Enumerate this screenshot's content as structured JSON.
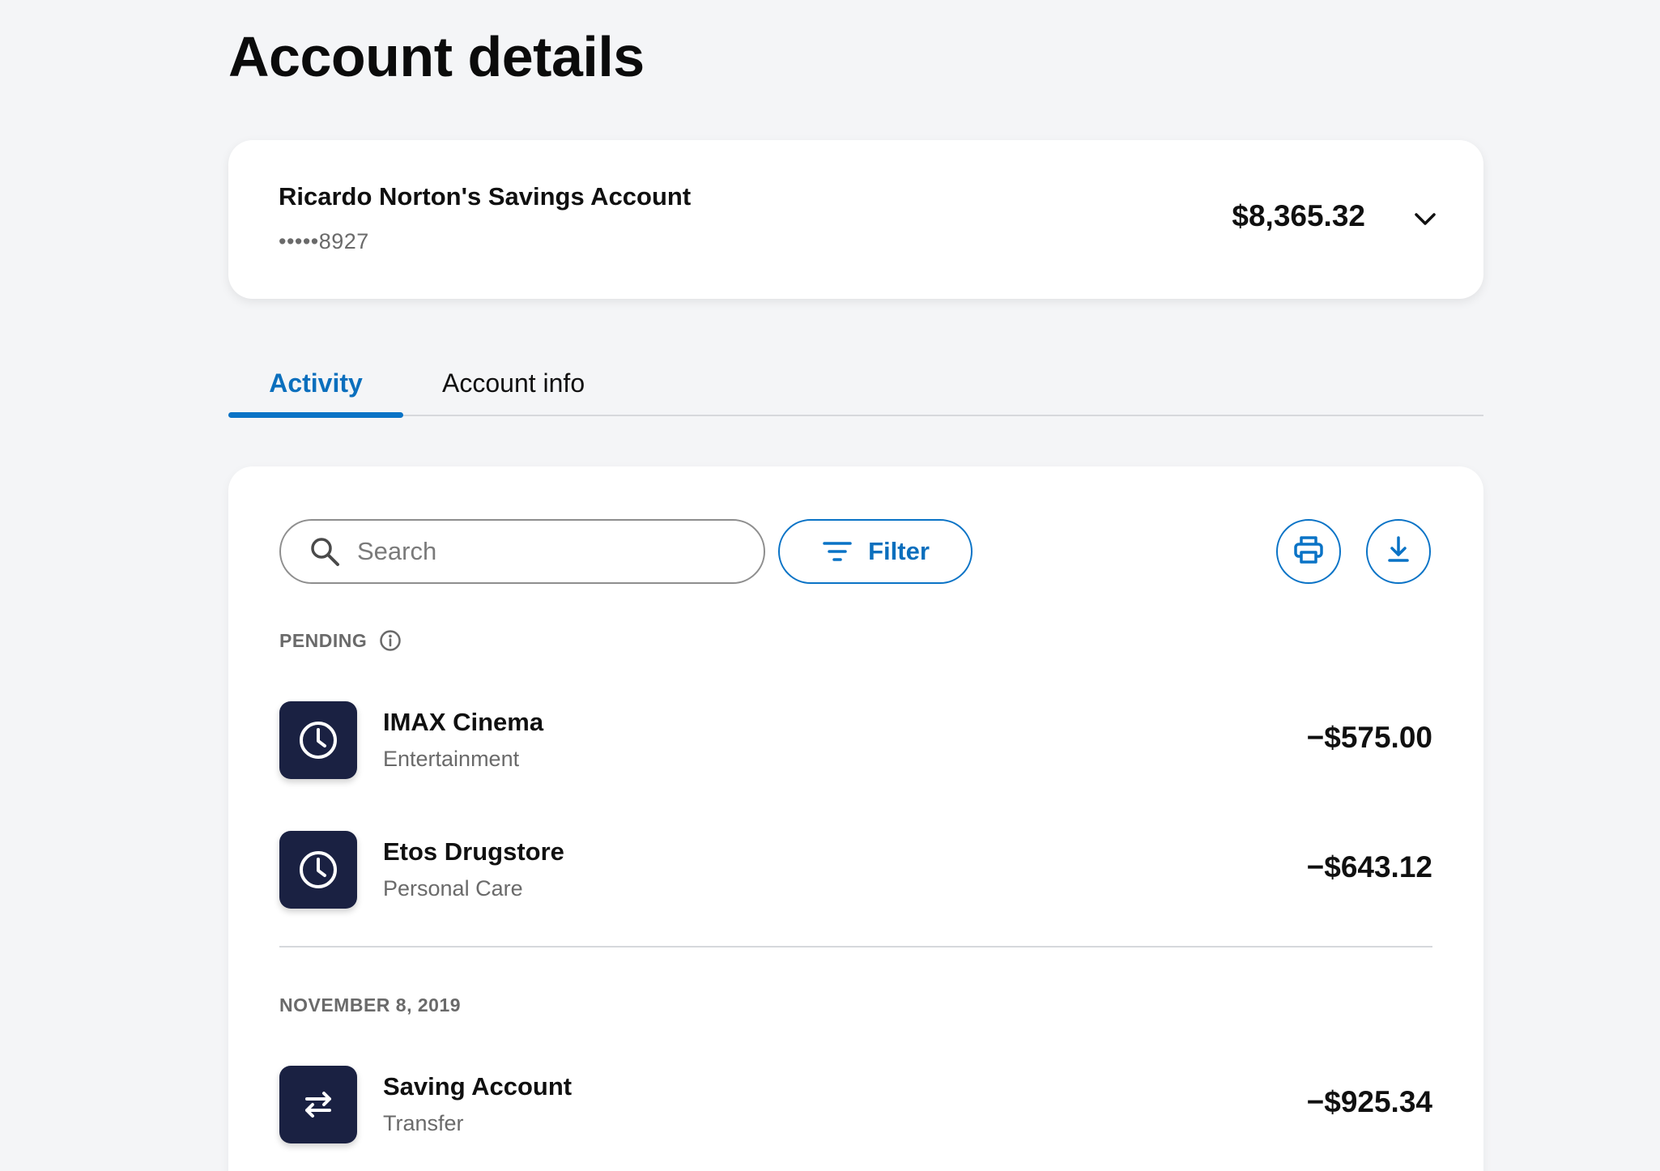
{
  "page": {
    "title": "Account details"
  },
  "account": {
    "name": "Ricardo Norton's Savings Account",
    "number": "•••••8927",
    "balance": "$8,365.32",
    "toggle_icon": "chevron-down-icon"
  },
  "tabs": [
    {
      "label": "Activity",
      "active": true
    },
    {
      "label": "Account info",
      "active": false
    }
  ],
  "toolbar": {
    "search_placeholder": "Search",
    "search_value": "",
    "filter_label": "Filter",
    "print_icon": "print-icon",
    "download_icon": "download-icon"
  },
  "sections": [
    {
      "label": "PENDING",
      "info_icon": "info-icon",
      "transactions": [
        {
          "name": "IMAX Cinema",
          "category": "Entertainment",
          "amount": "−$575.00",
          "icon": "clock-icon"
        },
        {
          "name": "Etos Drugstore",
          "category": "Personal Care",
          "amount": "−$643.12",
          "icon": "clock-icon"
        }
      ]
    },
    {
      "label": "NOVEMBER 8, 2019",
      "transactions": [
        {
          "name": "Saving Account",
          "category": "Transfer",
          "amount": "−$925.34",
          "icon": "transfer-arrows-icon"
        }
      ]
    }
  ],
  "colors": {
    "accent": "#0a73c6",
    "background": "#f4f5f7",
    "icon_tile": "#1a2142",
    "muted_text": "#6a6a6a"
  }
}
